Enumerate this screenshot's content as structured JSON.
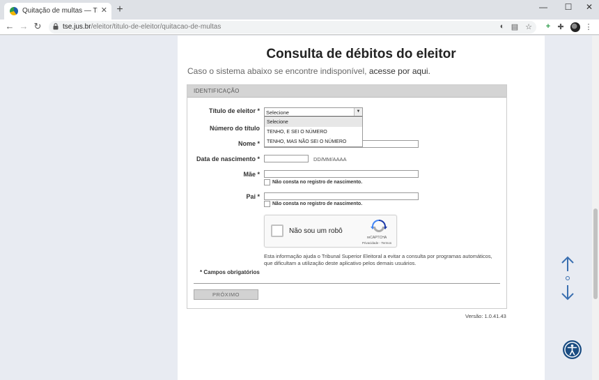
{
  "browser": {
    "tab_title": "Quitação de multas — Tribunal S",
    "new_tab": "+",
    "minimize": "—",
    "maximize": "☐",
    "close": "✕",
    "url_host": "tse.jus.br",
    "url_path": "/eleitor/titulo-de-eleitor/quitacao-de-multas"
  },
  "page": {
    "title": "Consulta de débitos do eleitor",
    "subtitle_prefix": "Caso o sistema abaixo se encontre indisponível,",
    "subtitle_link": "acesse por aqui."
  },
  "form": {
    "section_title": "IDENTIFICAÇÃO",
    "titulo_label": "Título de eleitor *",
    "titulo_selected": "Selecione",
    "titulo_options": [
      "Selecione",
      "TENHO, E SEI O NÚMERO",
      "TENHO, MAS NÃO SEI O NÚMERO"
    ],
    "numero_label": "Número do título",
    "nome_label": "Nome *",
    "nascimento_label": "Data de nascimento *",
    "nascimento_hint": "DD/MM/AAAA",
    "mae_label": "Mãe *",
    "mae_checkbox": "Não consta no registro de nascimento.",
    "pai_label": "Pai *",
    "pai_checkbox": "Não consta no registro de nascimento.",
    "recaptcha_label": "Não sou um robô",
    "recaptcha_brand": "reCAPTCHA",
    "recaptcha_links": "Privacidade - Termos",
    "info_text": "Esta informação ajuda o Tribunal Superior Eleitoral a evitar a consulta por programas automáticos, que dificultam a utilização deste aplicativo pelos demais usuários.",
    "required_note": "* Campos obrigatórios",
    "next_button": "PRÓXIMO"
  },
  "version": "Versão: 1.0.41.43",
  "colors": {
    "accent_dark_blue": "#1a4c82",
    "scroll_arrow_blue": "#3a6fb0",
    "section_header_gray": "#d4d4d4",
    "page_background": "#e8ebf2"
  }
}
